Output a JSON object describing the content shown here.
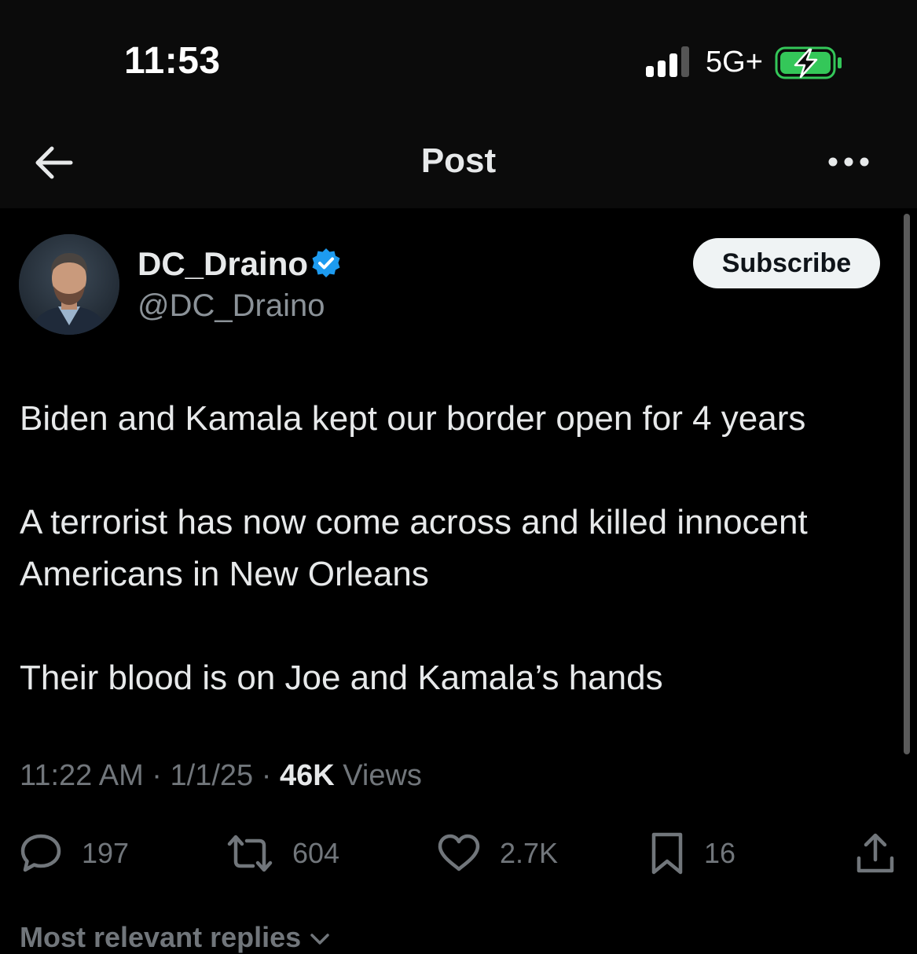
{
  "status_bar": {
    "time": "11:53",
    "network": "5G+",
    "signal_icon": "cellular-signal-icon",
    "battery_icon": "battery-charging-icon",
    "battery_color": "#34c759"
  },
  "nav": {
    "title": "Post",
    "back_icon": "back-arrow-icon",
    "more_icon": "more-options-icon"
  },
  "author": {
    "display_name": "DC_Draino",
    "handle": "@DC_Draino",
    "verified": true,
    "verified_color": "#1d9bf0",
    "subscribe_label": "Subscribe"
  },
  "post": {
    "paragraphs": [
      "Biden and Kamala kept our border open for 4 years",
      "A terrorist has now come across and killed innocent Americans in New Orleans",
      "Their blood is on Joe and Kamala’s hands"
    ],
    "time": "11:22 AM",
    "date": "1/1/25",
    "views_count": "46K",
    "views_label": "Views",
    "separator": "·"
  },
  "actions": {
    "replies": "197",
    "reposts": "604",
    "likes": "2.7K",
    "bookmarks": "16"
  },
  "replies_header": "Most relevant replies"
}
